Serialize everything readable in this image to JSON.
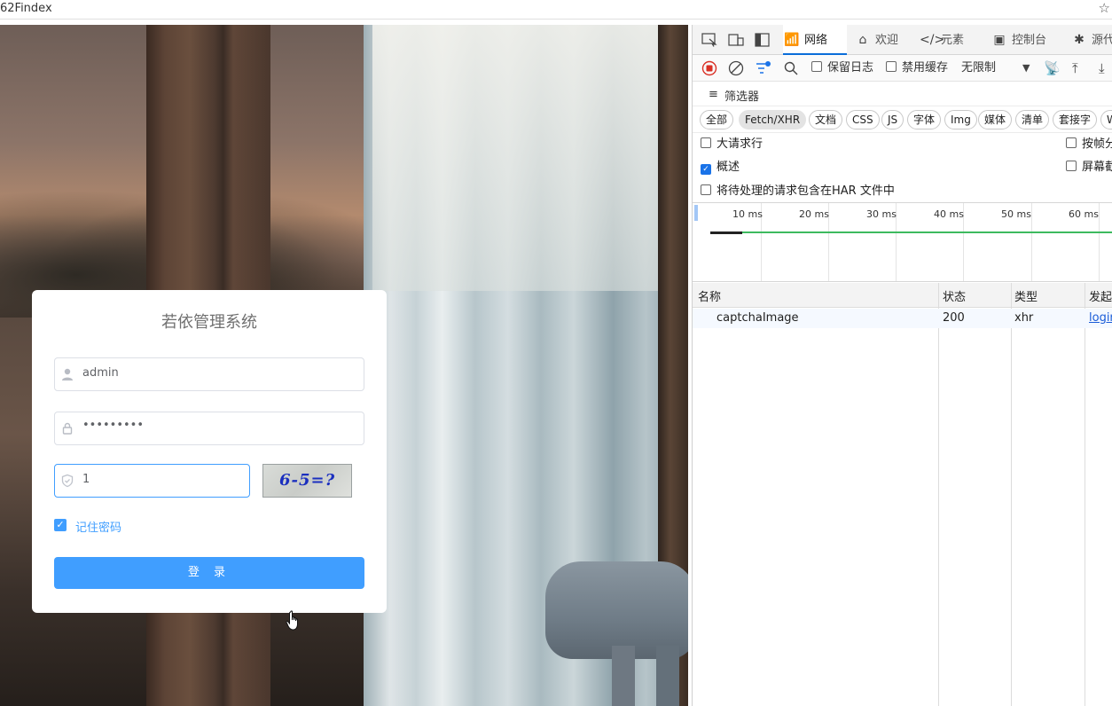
{
  "browser": {
    "url_fragment": "62Findex",
    "favorite_icon": "star-outline-icon"
  },
  "login": {
    "title": "若依管理系统",
    "username_value": "admin",
    "password_value": "•••••••••",
    "code_value": "1",
    "captcha_text": "6-5=?",
    "remember_label": "记住密码",
    "remember_checked": true,
    "login_button": "登 录"
  },
  "devtools": {
    "tabs": [
      {
        "label": "网络",
        "icon": "wifi-icon",
        "active": true
      },
      {
        "label": "欢迎",
        "icon": "home-icon",
        "active": false
      },
      {
        "label": "元素",
        "icon": "code-icon",
        "active": false
      },
      {
        "label": "控制台",
        "icon": "console-icon",
        "active": false
      },
      {
        "label": "源代",
        "icon": "bug-icon",
        "active": false
      }
    ],
    "toolbar": {
      "preserve_log": "保留日志",
      "disable_cache": "禁用缓存",
      "throttle": "无限制"
    },
    "filter_label": "筛选器",
    "resource_types": [
      "全部",
      "Fetch/XHR",
      "文档",
      "CSS",
      "JS",
      "字体",
      "Img",
      "媒体",
      "清单",
      "套接字",
      "W"
    ],
    "selected_type": "Fetch/XHR",
    "options": {
      "large_rows": "大请求行",
      "overview": "概述",
      "include_pending_har": "将待处理的请求包含在HAR 文件中",
      "group_by_frame": "按帧分",
      "screenshot": "屏幕截"
    },
    "timeline_ticks": [
      "10 ms",
      "20 ms",
      "30 ms",
      "40 ms",
      "50 ms",
      "60 ms"
    ],
    "table": {
      "headers": [
        "名称",
        "状态",
        "类型",
        "发起"
      ],
      "rows": [
        {
          "name": "captchaImage",
          "status": "200",
          "type": "xhr",
          "initiator": "login"
        }
      ]
    }
  }
}
